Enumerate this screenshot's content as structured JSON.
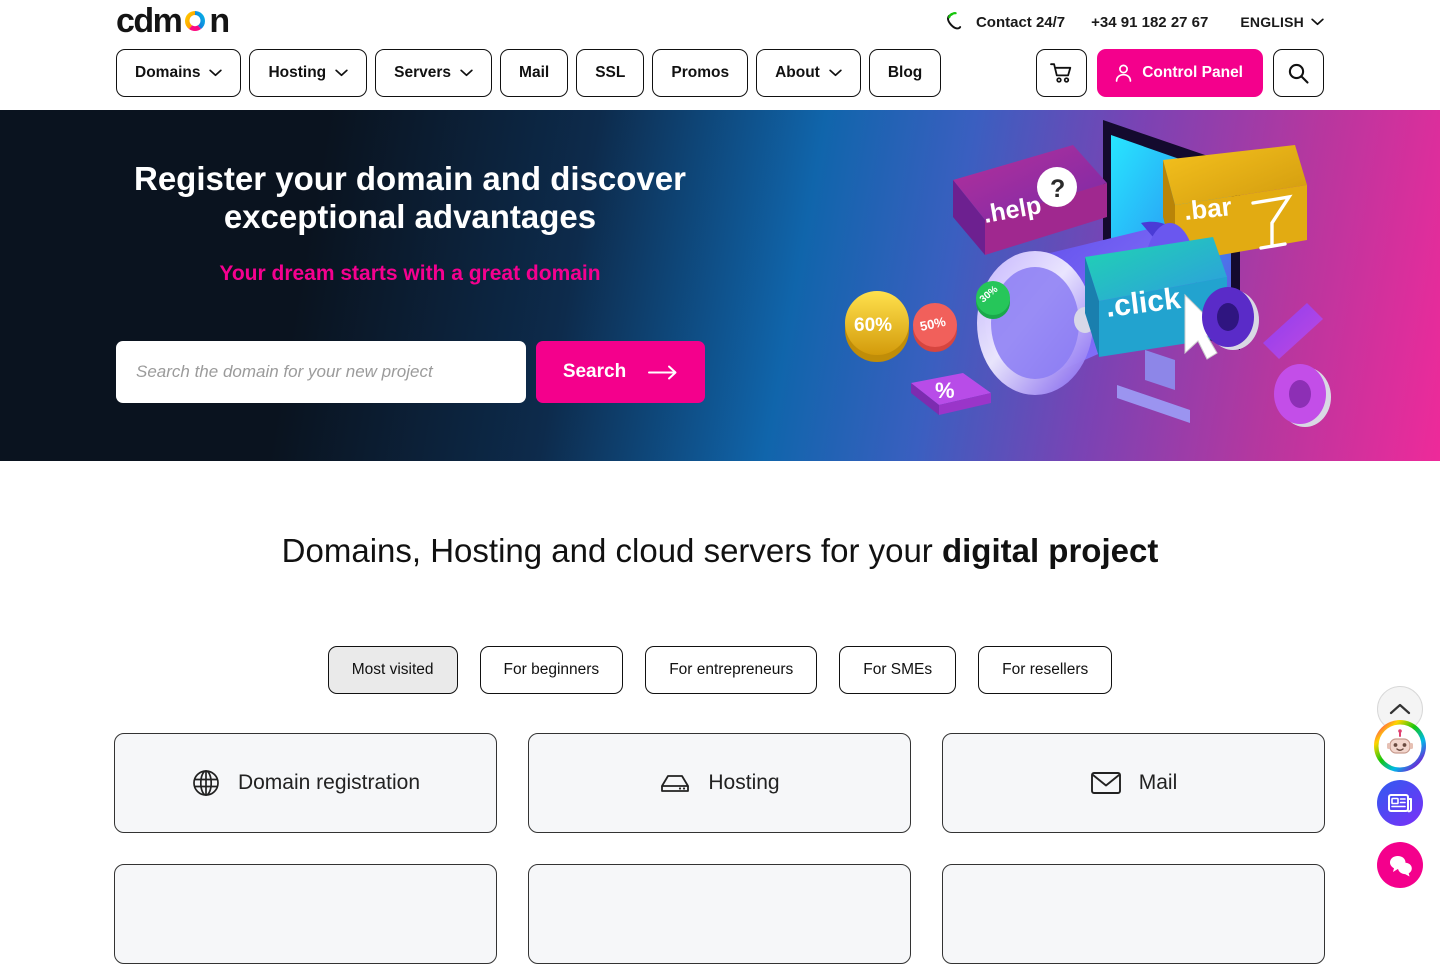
{
  "brand": {
    "logo_text_before": "cdm",
    "logo_text_after": "n",
    "logo_full": "cdmon",
    "accent_pink": "#f4008c",
    "hero_dark": "#0a131f",
    "hero_pink": "#ee2a9a"
  },
  "utility": {
    "phone_icon": "phone-call-icon",
    "contact_label": "Contact 24/7",
    "phone_number": "+34 91 182 27 67",
    "language": "ENGLISH",
    "language_chevron": "chevron-down-icon"
  },
  "nav": {
    "items": [
      {
        "label": "Domains",
        "has_chevron": true,
        "icon": "chevron-down-icon"
      },
      {
        "label": "Hosting",
        "has_chevron": true,
        "icon": "chevron-down-icon"
      },
      {
        "label": "Servers",
        "has_chevron": true,
        "icon": "chevron-down-icon"
      },
      {
        "label": "Mail",
        "has_chevron": false,
        "icon": ""
      },
      {
        "label": "SSL",
        "has_chevron": false,
        "icon": ""
      },
      {
        "label": "Promos",
        "has_chevron": false,
        "icon": ""
      },
      {
        "label": "About",
        "has_chevron": true,
        "icon": "chevron-down-icon"
      },
      {
        "label": "Blog",
        "has_chevron": false,
        "icon": ""
      }
    ],
    "cart_icon": "shopping-cart-icon",
    "control_panel_label": "Control Panel",
    "control_panel_icon": "user-icon",
    "search_icon": "search-icon"
  },
  "hero": {
    "heading": "Register your domain and discover exceptional advantages",
    "subheading": "Your dream starts with a great domain",
    "search_placeholder": "Search the domain for your new project",
    "search_value": "",
    "search_button": "Search",
    "search_button_icon": "arrow-right-icon",
    "illustration": {
      "name": "megaphone-domains-illustration",
      "tags": [
        ".help",
        ".bar",
        ".click"
      ],
      "badges": [
        "60%",
        "50%",
        "30%"
      ],
      "symbols": [
        "%",
        "0",
        "?",
        "cocktail-glass",
        "cursor-arrow"
      ]
    }
  },
  "section": {
    "title_normal": "Domains, Hosting and cloud servers for your ",
    "title_bold": "digital project",
    "tabs": [
      {
        "label": "Most visited",
        "active": true
      },
      {
        "label": "For beginners",
        "active": false
      },
      {
        "label": "For entrepreneurs",
        "active": false
      },
      {
        "label": "For SMEs",
        "active": false
      },
      {
        "label": "For resellers",
        "active": false
      }
    ],
    "cards": [
      {
        "label": "Domain registration",
        "icon": "globe-icon"
      },
      {
        "label": "Hosting",
        "icon": "server-icon"
      },
      {
        "label": "Mail",
        "icon": "envelope-icon"
      }
    ]
  },
  "floating": {
    "scroll_top_icon": "chevron-up-icon",
    "assistant_icon": "robot-assistant-avatar-icon",
    "news_icon": "newspaper-icon",
    "chat_icon": "chat-bubbles-icon"
  }
}
